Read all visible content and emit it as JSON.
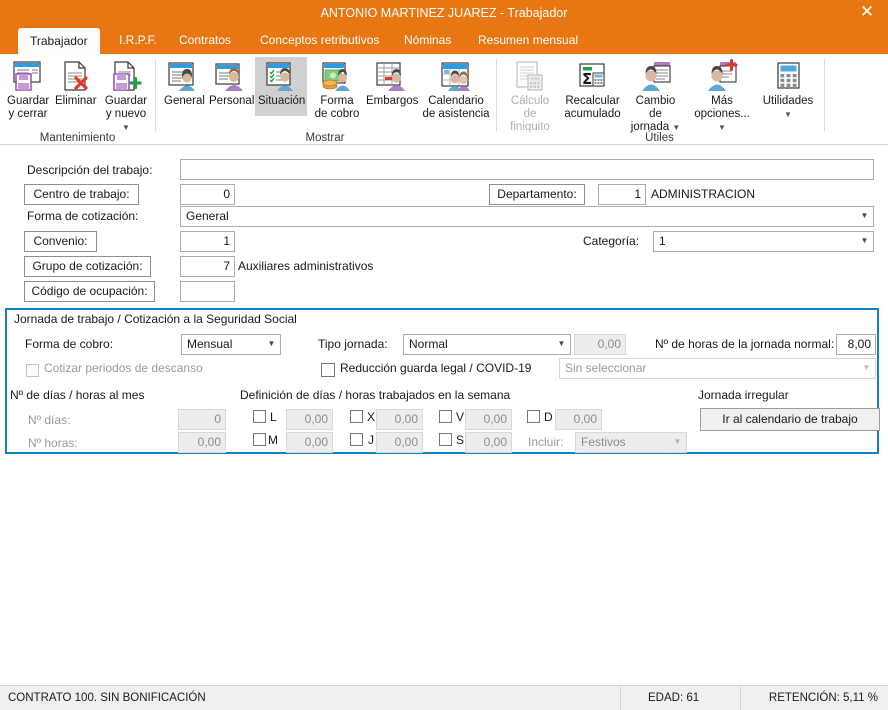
{
  "window": {
    "title": "ANTONIO MARTINEZ JUAREZ - Trabajador",
    "close_icon": "✕",
    "accent_color": "#E87613",
    "highlight_color": "#0F80C1"
  },
  "tabs": [
    {
      "label": "Trabajador",
      "active": true
    },
    {
      "label": "I.R.P.F.",
      "active": false
    },
    {
      "label": "Contratos",
      "active": false
    },
    {
      "label": "Conceptos retributivos",
      "active": false
    },
    {
      "label": "Nóminas",
      "active": false
    },
    {
      "label": "Resumen mensual",
      "active": false
    }
  ],
  "ribbon": {
    "groups": [
      {
        "label": "Mantenimiento"
      },
      {
        "label": "Mostrar"
      },
      {
        "label": "Útiles"
      }
    ],
    "buttons": [
      {
        "line1": "Guardar",
        "line2": "y cerrar",
        "icon": "save-close-icon",
        "state": "normal",
        "caret": false
      },
      {
        "line1": "Eliminar",
        "line2": "",
        "icon": "delete-document-icon",
        "state": "normal",
        "caret": false
      },
      {
        "line1": "Guardar",
        "line2": "y nuevo",
        "icon": "save-new-icon",
        "state": "normal",
        "caret": true
      },
      {
        "line1": "General",
        "line2": "",
        "icon": "general-person-icon",
        "state": "normal",
        "caret": false
      },
      {
        "line1": "Personal",
        "line2": "",
        "icon": "personal-person-icon",
        "state": "normal",
        "caret": false
      },
      {
        "line1": "Situación",
        "line2": "",
        "icon": "situation-person-icon",
        "state": "selected",
        "caret": false
      },
      {
        "line1": "Forma",
        "line2": "de cobro",
        "icon": "payment-coins-icon",
        "state": "normal",
        "caret": false
      },
      {
        "line1": "Embargos",
        "line2": "",
        "icon": "garnishment-icon",
        "state": "normal",
        "caret": false
      },
      {
        "line1": "Calendario",
        "line2": "de asistencia",
        "icon": "attendance-calendar-icon",
        "state": "normal",
        "caret": false
      },
      {
        "line1": "Cálculo de",
        "line2": "finiquito",
        "icon": "settlement-calc-icon",
        "state": "disabled",
        "caret": false
      },
      {
        "line1": "Recalcular",
        "line2": "acumulado",
        "icon": "sum-recalc-icon",
        "state": "normal",
        "caret": false
      },
      {
        "line1": "Cambio de",
        "line2": "jornada",
        "icon": "shift-change-icon",
        "state": "normal",
        "caret": true
      },
      {
        "line1": "Más",
        "line2": "opciones...",
        "icon": "more-options-icon",
        "state": "normal",
        "caret": true
      },
      {
        "line1": "Utilidades",
        "line2": "",
        "icon": "calculator-icon",
        "state": "normal",
        "caret": true
      }
    ]
  },
  "form": {
    "descripcion_label": "Descripción del trabajo:",
    "descripcion_value": "",
    "centro_button": "Centro de trabajo:",
    "centro_value": "0",
    "departamento_button": "Departamento:",
    "departamento_code": "1",
    "departamento_name": "ADMINISTRACION",
    "forma_cotizacion_label": "Forma de cotización:",
    "forma_cotizacion_value": "General",
    "convenio_button": "Convenio:",
    "convenio_value": "1",
    "categoria_label": "Categoría:",
    "categoria_value": "1",
    "grupo_button": "Grupo de cotización:",
    "grupo_value": "7",
    "grupo_name": "Auxiliares administrativos",
    "codigo_button": "Código de ocupación:",
    "codigo_value": ""
  },
  "jornada": {
    "panel_title": "Jornada de trabajo / Cotización a la Seguridad Social",
    "forma_cobro_label": "Forma de cobro:",
    "forma_cobro_value": "Mensual",
    "tipo_jornada_label": "Tipo jornada:",
    "tipo_jornada_value": "Normal",
    "tipo_jornada_num": "0,00",
    "horas_normal_label": "Nº de horas de la jornada normal:",
    "horas_normal_value": "8,00",
    "cotizar_descanso_label": "Cotizar periodos de descanso",
    "cotizar_descanso_checked": false,
    "reduccion_label": "Reducción guarda legal / COVID-19",
    "reduccion_checked": false,
    "reduccion_combo_value": "Sin seleccionar",
    "dias_mes_header": "Nº de días / horas al mes",
    "n_dias_label": "Nº días:",
    "n_dias_value": "0",
    "n_horas_label": "Nº horas:",
    "n_horas_value": "0,00",
    "semana_header": "Definición de días / horas trabajados en la semana",
    "dias_semana": [
      {
        "code": "L",
        "value": "0,00",
        "checked": false
      },
      {
        "code": "M",
        "value": "0,00",
        "checked": false
      },
      {
        "code": "X",
        "value": "0,00",
        "checked": false
      },
      {
        "code": "J",
        "value": "0,00",
        "checked": false
      },
      {
        "code": "V",
        "value": "0,00",
        "checked": false
      },
      {
        "code": "S",
        "value": "0,00",
        "checked": false
      },
      {
        "code": "D",
        "value": "0,00",
        "checked": false
      }
    ],
    "incluir_label": "Incluir:",
    "incluir_value": "Festivos",
    "irregular_header": "Jornada irregular",
    "irregular_button": "Ir al calendario de trabajo"
  },
  "status": {
    "contrato": "CONTRATO 100.  SIN BONIFICACIÓN",
    "edad": "EDAD: 61",
    "retencion": "RETENCIÓN: 5,11 %"
  }
}
